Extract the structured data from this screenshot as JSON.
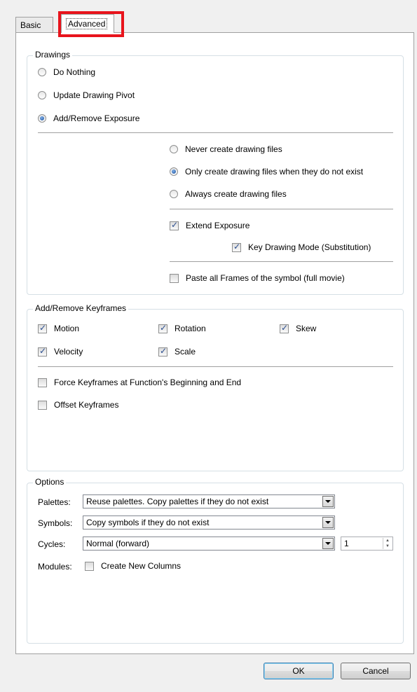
{
  "tabs": [
    {
      "label": "Basic"
    },
    {
      "label": "Advanced",
      "selected": true
    }
  ],
  "highlight_color": "#e8141c",
  "drawings": {
    "title": "Drawings",
    "options": [
      {
        "label": "Do Nothing",
        "selected": false
      },
      {
        "label": "Update Drawing Pivot",
        "selected": false
      },
      {
        "label": "Add/Remove Exposure",
        "selected": true
      }
    ],
    "file_options": [
      {
        "label": "Never create drawing files",
        "selected": false
      },
      {
        "label": "Only create drawing files when they do not exist",
        "selected": true
      },
      {
        "label": "Always create drawing files",
        "selected": false
      }
    ],
    "extend_exposure": {
      "label": "Extend Exposure",
      "checked": true
    },
    "key_drawing_mode": {
      "label": "Key Drawing Mode (Substitution)",
      "checked": true
    },
    "paste_all_frames": {
      "label": "Paste all Frames of the symbol (full movie)",
      "checked": false
    }
  },
  "keyframes": {
    "title": "Add/Remove Keyframes",
    "motion": {
      "label": "Motion",
      "checked": true
    },
    "rotation": {
      "label": "Rotation",
      "checked": true
    },
    "skew": {
      "label": "Skew",
      "checked": true
    },
    "velocity": {
      "label": "Velocity",
      "checked": true
    },
    "scale": {
      "label": "Scale",
      "checked": true
    },
    "force": {
      "label": "Force Keyframes at Function's Beginning and End",
      "checked": false
    },
    "offset": {
      "label": "Offset Keyframes",
      "checked": false
    }
  },
  "options": {
    "title": "Options",
    "palettes": {
      "label": "Palettes:",
      "value": "Reuse palettes. Copy palettes if they do not exist"
    },
    "symbols": {
      "label": "Symbols:",
      "value": "Copy symbols if they do not exist"
    },
    "cycles": {
      "label": "Cycles:",
      "value": "Normal (forward)",
      "count": "1"
    },
    "modules": {
      "label": "Modules:",
      "checkbox_label": "Create New Columns",
      "checked": false
    }
  },
  "buttons": {
    "ok": "OK",
    "cancel": "Cancel"
  }
}
